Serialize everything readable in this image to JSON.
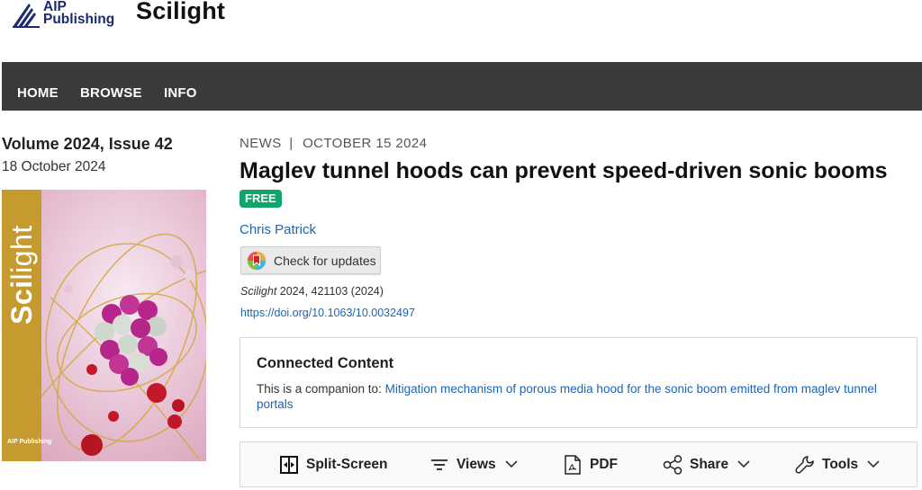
{
  "header": {
    "publisher_line1": "AIP",
    "publisher_line2": "Publishing",
    "site_title": "Scilight"
  },
  "nav": {
    "items": [
      {
        "label": "HOME"
      },
      {
        "label": "BROWSE"
      },
      {
        "label": "INFO"
      }
    ]
  },
  "sidebar": {
    "issue_title": "Volume 2024, Issue 42",
    "issue_date": "18 October 2024",
    "cover": {
      "word_bold": "Sci",
      "word_light": "light",
      "publisher": "AIP Publishing",
      "band_color": "#c59a2f"
    }
  },
  "article": {
    "category": "NEWS",
    "separator": "|",
    "date": "OCTOBER 15 2024",
    "title": "Maglev tunnel hoods can prevent speed-driven sonic booms",
    "badge": "FREE",
    "author": "Chris Patrick",
    "check_updates": "Check for updates",
    "citation_journal": "Scilight",
    "citation_rest": " 2024, 421103 (2024)",
    "doi": "https://doi.org/10.1063/10.0032497"
  },
  "connected": {
    "title": "Connected Content",
    "prefix": "This is a companion to: ",
    "link": "Mitigation mechanism of porous media hood for the sonic boom emitted from maglev tunnel portals"
  },
  "toolbar": {
    "split_screen": "Split-Screen",
    "views": "Views",
    "pdf": "PDF",
    "share": "Share",
    "tools": "Tools"
  },
  "colors": {
    "nav_bg": "#3a3a3a",
    "link": "#1a66b5",
    "free_badge": "#11a56e"
  }
}
